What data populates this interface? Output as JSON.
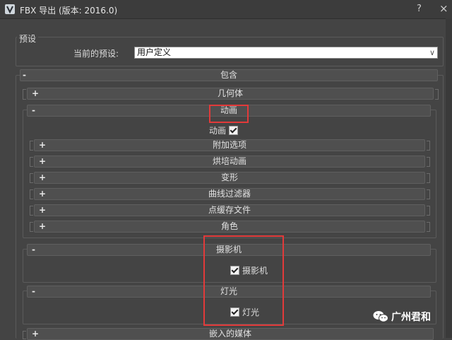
{
  "window": {
    "title": "FBX 导出 (版本: 2016.0)",
    "help": "?",
    "close": "×"
  },
  "preset": {
    "group_title": "预设",
    "label": "当前的预设:",
    "value": "用户定义"
  },
  "include": {
    "title": "包含",
    "sign": "-",
    "geometry": {
      "label": "几何体",
      "sign": "+"
    },
    "animation": {
      "label": "动画",
      "sign": "-",
      "checkbox_label": "动画",
      "sub_rollouts": [
        {
          "label": "附加选项",
          "sign": "+"
        },
        {
          "label": "烘培动画",
          "sign": "+"
        },
        {
          "label": "变形",
          "sign": "+"
        },
        {
          "label": "曲线过滤器",
          "sign": "+"
        },
        {
          "label": "点缓存文件",
          "sign": "+"
        },
        {
          "label": "角色",
          "sign": "+"
        }
      ]
    },
    "camera": {
      "label": "摄影机",
      "sign": "-",
      "checkbox_label": "摄影机"
    },
    "light": {
      "label": "灯光",
      "sign": "-",
      "checkbox_label": "灯光"
    },
    "embed_media": {
      "label": "嵌入的媒体",
      "sign": "+"
    }
  },
  "watermark": {
    "text": "广州君和"
  },
  "colors": {
    "highlight": "#e23a3a",
    "panel_bg": "#444444"
  }
}
